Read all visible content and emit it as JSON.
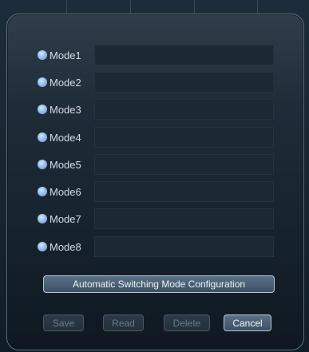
{
  "modes": [
    {
      "label": "Mode1",
      "value": ""
    },
    {
      "label": "Mode2",
      "value": ""
    },
    {
      "label": "Mode3",
      "value": ""
    },
    {
      "label": "Mode4",
      "value": ""
    },
    {
      "label": "Mode5",
      "value": ""
    },
    {
      "label": "Mode6",
      "value": ""
    },
    {
      "label": "Mode7",
      "value": ""
    },
    {
      "label": "Mode8",
      "value": ""
    }
  ],
  "auto_switch_button": {
    "label": "Automatic Switching Mode Configuration"
  },
  "actions": {
    "save": {
      "label": "Save",
      "enabled": false
    },
    "read": {
      "label": "Read",
      "enabled": false
    },
    "delete": {
      "label": "Delete",
      "enabled": false
    },
    "cancel": {
      "label": "Cancel",
      "enabled": true
    }
  },
  "colors": {
    "dialog_bg": "#1b2834",
    "radio": "#8fb8e8",
    "accent_button": "#4a6076"
  }
}
